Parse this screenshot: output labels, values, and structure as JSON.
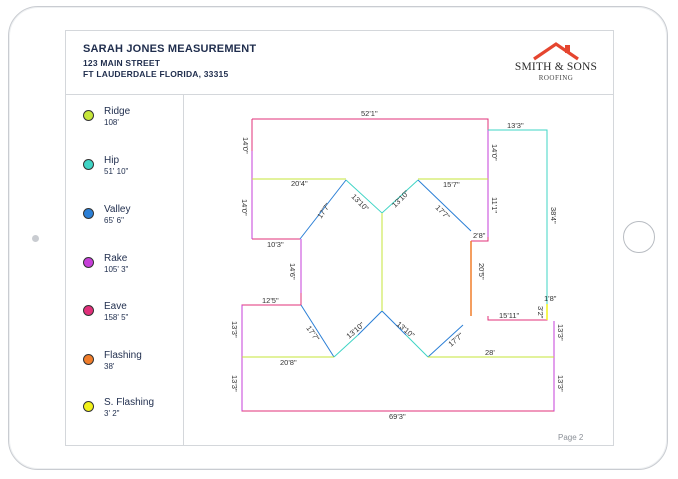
{
  "header": {
    "title": "SARAH JONES MEASUREMENT",
    "address_line1": "123 MAIN STREET",
    "address_line2": "FT LAUDERDALE FLORIDA, 33315"
  },
  "logo": {
    "name": "SMITH & SONS",
    "subtitle": "ROOFING",
    "roof_color": "#e5452f"
  },
  "legend": [
    {
      "name": "Ridge",
      "value": "108'",
      "color": "#c6e63a"
    },
    {
      "name": "Hip",
      "value": "51' 10\"",
      "color": "#3fd4c5"
    },
    {
      "name": "Valley",
      "value": "65' 6\"",
      "color": "#2b7fd6"
    },
    {
      "name": "Rake",
      "value": "105' 3\"",
      "color": "#c63fd8"
    },
    {
      "name": "Eave",
      "value": "158' 5\"",
      "color": "#e0307a"
    },
    {
      "name": "Flashing",
      "value": "38'",
      "color": "#f07d2a"
    },
    {
      "name": "S. Flashing",
      "value": "3' 2\"",
      "color": "#f2f21a"
    }
  ],
  "labels": {
    "top_width": "52'1\"",
    "top_right_ext": "13'3\"",
    "left_top_height": "14'0\"",
    "right_top_height": "14'0\"",
    "left_ridge": "20'4\"",
    "right_ridge": "15'7\"",
    "left_mid_height": "14'0\"",
    "left_valley": "17'7\"",
    "center_hip_left": "13'10\"",
    "center_hip_right": "13'10\"",
    "right_valley": "17'7\"",
    "right_height": "11'1\"",
    "far_right_height": "38'4\"",
    "left_notch": "10'3\"",
    "right_step": "2'8\"",
    "left_waist": "14'6\"",
    "flashing": "20'5\"",
    "left_lower_notch": "12'5\"",
    "small_step": "1'8\"",
    "right_lower_ext": "15'11\"",
    "tiny_step": "3'2\"",
    "lower_left_valley": "17'7\"",
    "lower_hip_left": "13'10\"",
    "lower_hip_right": "13'10\"",
    "lower_right_valley": "17'7\"",
    "left_lower_height1": "13'3\"",
    "right_lower_height1": "13'3\"",
    "left_lower_ridge": "20'8\"",
    "right_lower_ridge": "28'",
    "left_lower_height2": "13'3\"",
    "right_lower_height2": "13'3\"",
    "bottom_width": "69'3\""
  },
  "footer": {
    "page": "Page 2"
  }
}
